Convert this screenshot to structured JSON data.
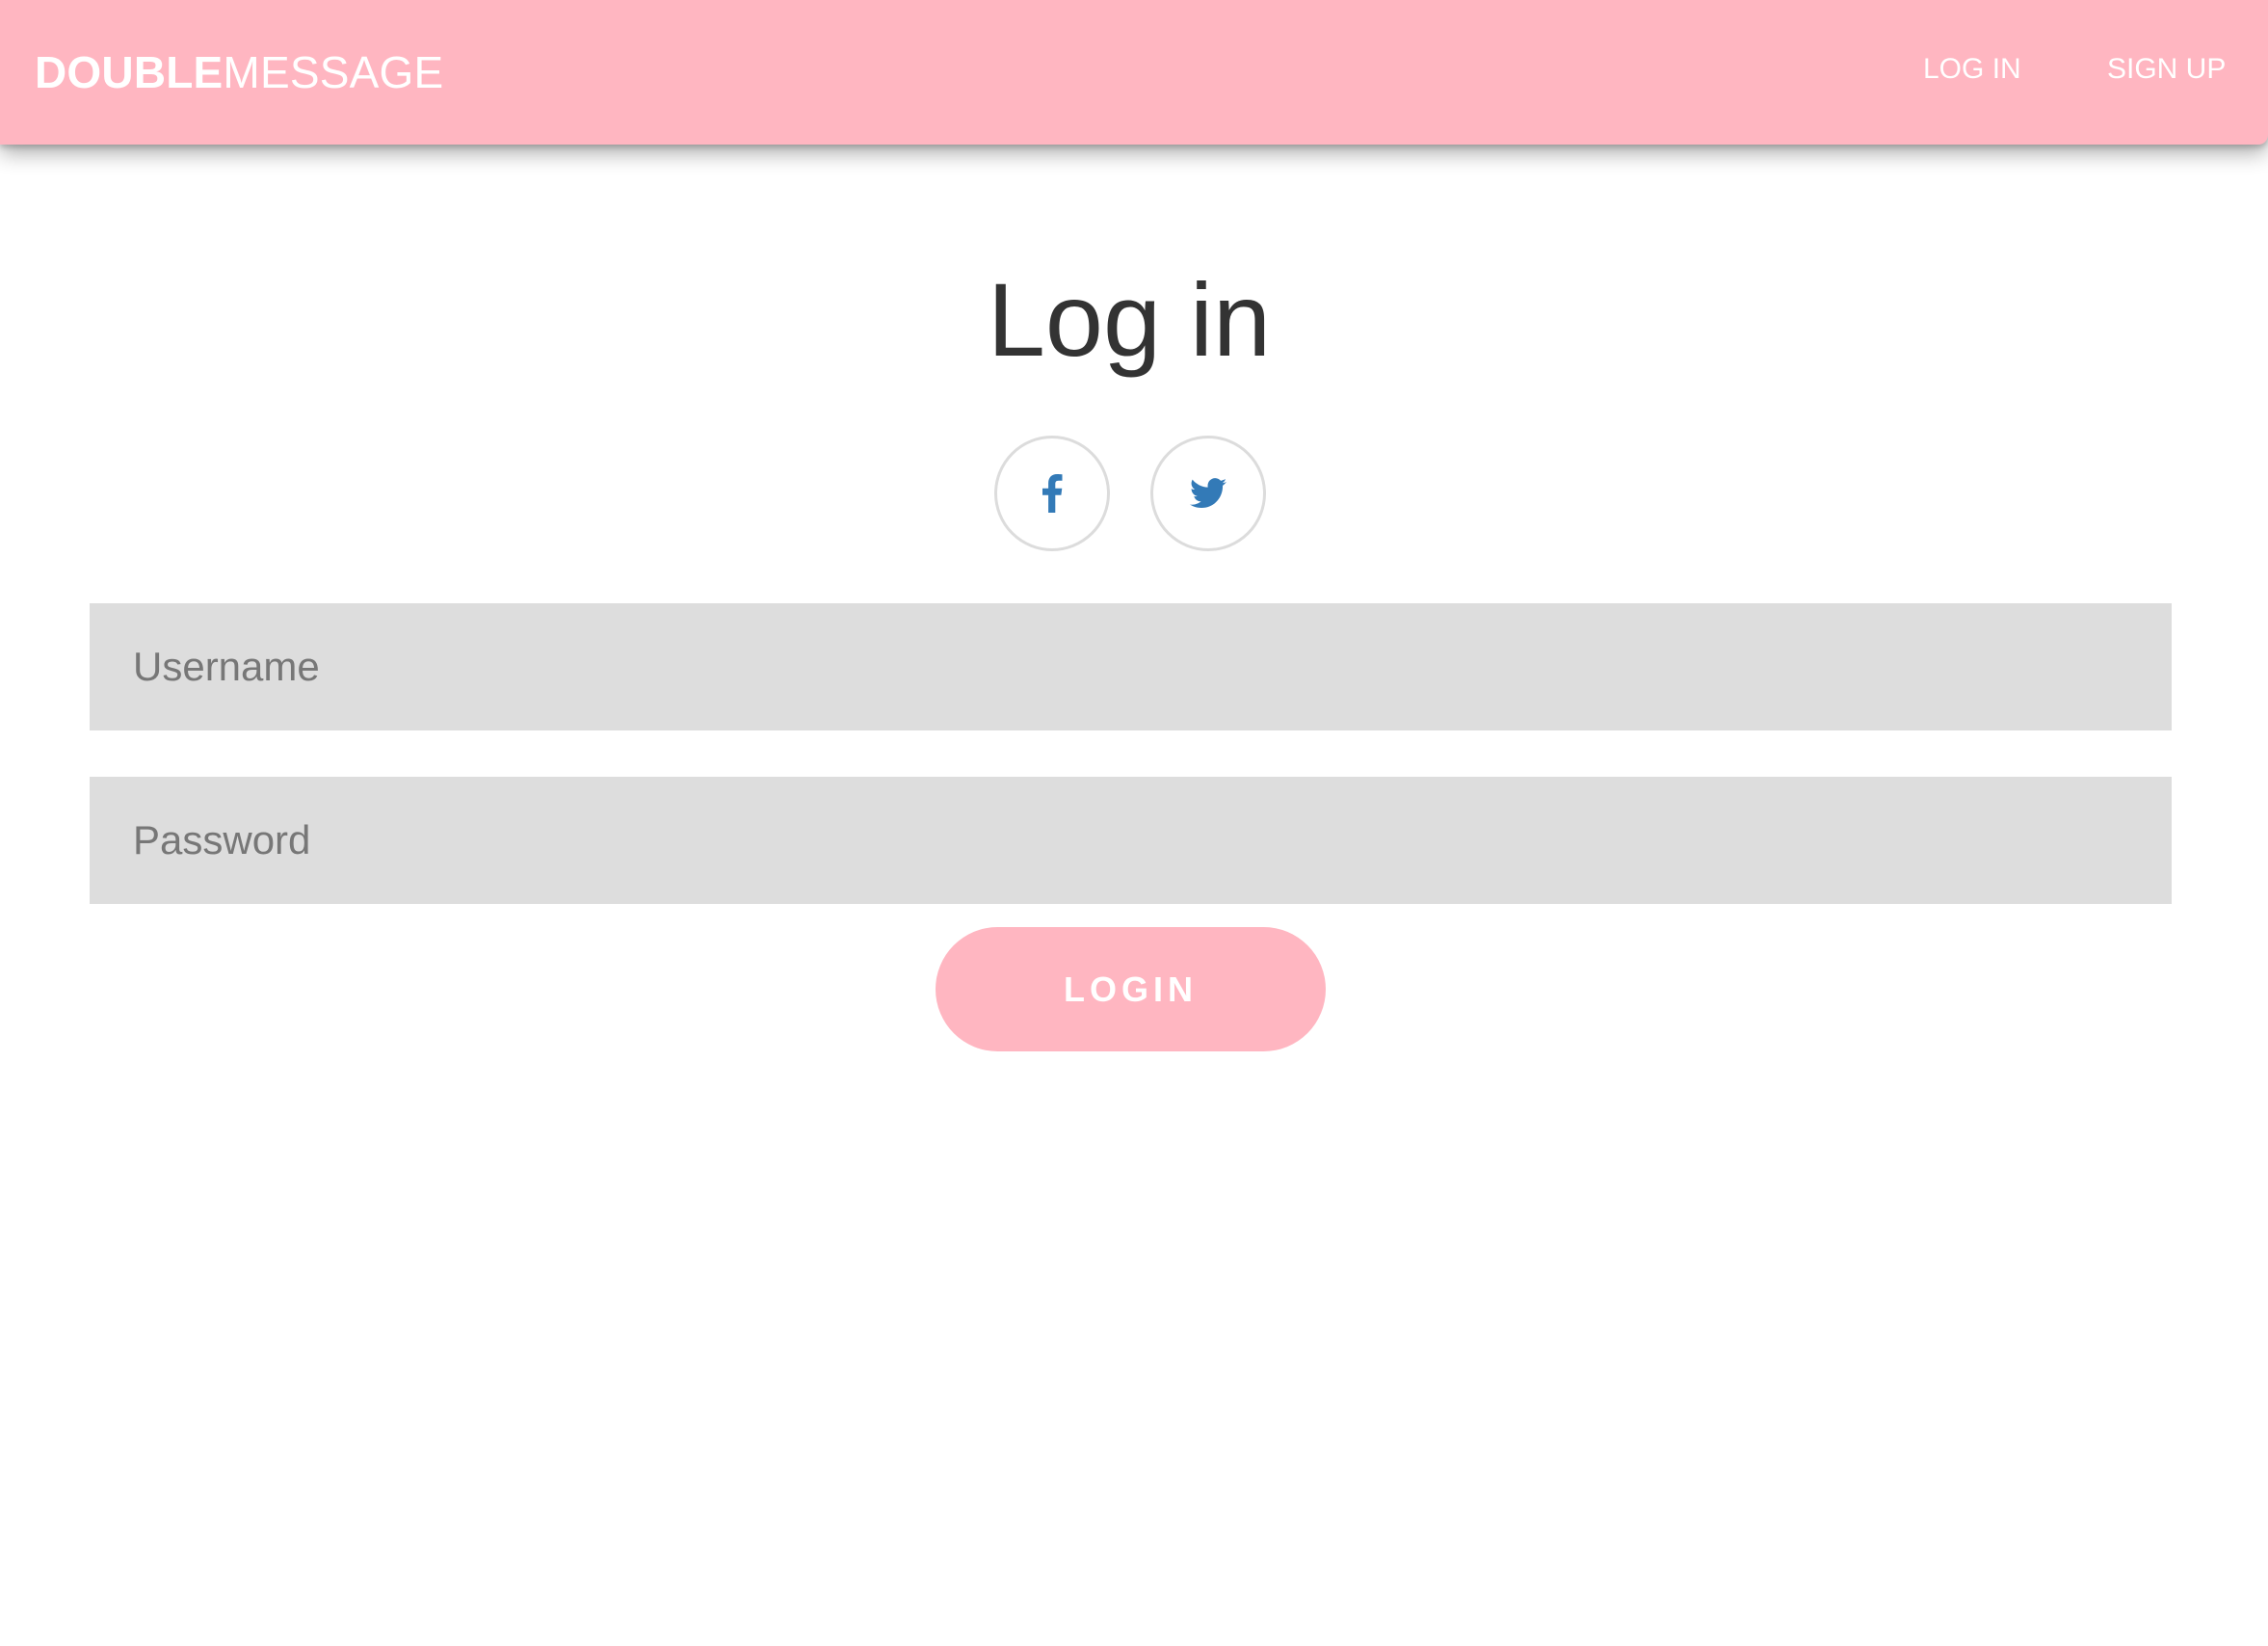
{
  "navbar": {
    "brand_bold": "DOUBLE",
    "brand_light": "MESSAGE",
    "links": [
      {
        "label": "LOG IN"
      },
      {
        "label": "SIGN UP"
      }
    ],
    "background_color": "#ffb6c1"
  },
  "main": {
    "title": "Log in",
    "social_buttons": [
      {
        "icon": "facebook-icon"
      },
      {
        "icon": "twitter-icon"
      }
    ],
    "username_field": {
      "placeholder": "Username",
      "value": ""
    },
    "password_field": {
      "placeholder": "Password",
      "value": ""
    },
    "login_button_label": "LOGIN"
  },
  "colors": {
    "accent": "#ffb6c1",
    "social_icon": "#337ab7",
    "input_background": "#dddddd",
    "title_text": "#333333"
  }
}
